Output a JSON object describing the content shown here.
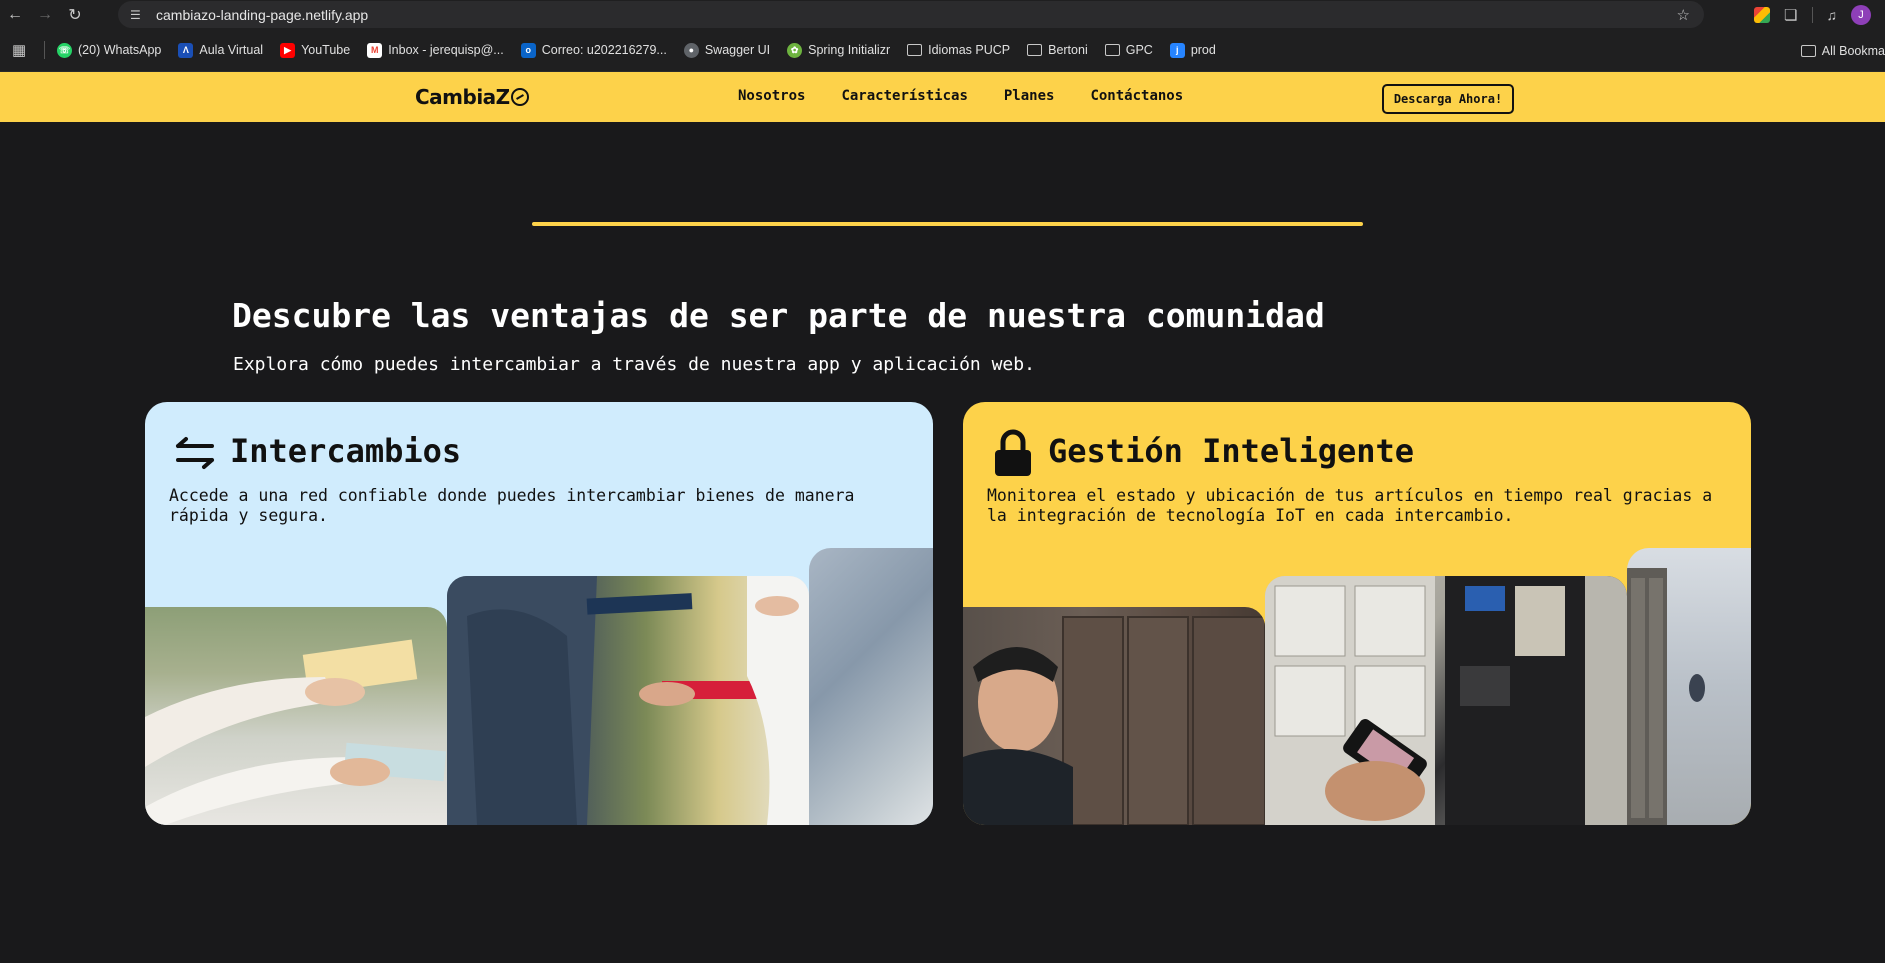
{
  "browser": {
    "url": "cambiazo-landing-page.netlify.app",
    "profile_initial": "J",
    "bookmarks": [
      {
        "label": "(20) WhatsApp",
        "icon": "whatsapp-icon",
        "color": "#25d366"
      },
      {
        "label": "Aula Virtual",
        "icon": "aula-virtual-icon",
        "color": "#1a4fb6"
      },
      {
        "label": "YouTube",
        "icon": "youtube-icon",
        "color": "#ff0000"
      },
      {
        "label": "Inbox - jerequisp@...",
        "icon": "gmail-icon",
        "color": "#ea4335"
      },
      {
        "label": "Correo: u202216279...",
        "icon": "outlook-icon",
        "color": "#0a64c8"
      },
      {
        "label": "Swagger UI",
        "icon": "globe-icon",
        "color": "#5f6368"
      },
      {
        "label": "Spring Initializr",
        "icon": "spring-icon",
        "color": "#6db33f"
      },
      {
        "label": "Idiomas PUCP",
        "icon": "folder-icon"
      },
      {
        "label": "Bertoni",
        "icon": "folder-icon"
      },
      {
        "label": "GPC",
        "icon": "folder-icon"
      },
      {
        "label": "prod",
        "icon": "jira-icon",
        "color": "#2684ff"
      }
    ],
    "all_bookmarks_label": "All Bookma"
  },
  "site": {
    "logo_text": "CambiaZ",
    "nav": [
      "Nosotros",
      "Características",
      "Planes",
      "Contáctanos"
    ],
    "cta_label": "Descarga Ahora!",
    "heading": "Descubre las ventajas de ser parte de nuestra comunidad",
    "subheading": "Explora cómo puedes intercambiar a través de nuestra app y aplicación web.",
    "cards": [
      {
        "title": "Intercambios",
        "icon": "exchange-arrows-icon",
        "description": "Accede a una red confiable donde puedes intercambiar bienes de manera rápida y segura.",
        "bg": "#d0ecfd"
      },
      {
        "title": "Gestión Inteligente",
        "icon": "lock-icon",
        "description": "Monitorea el estado y ubicación de tus artículos en tiempo real gracias a la integración de tecnología IoT en cada intercambio.",
        "bg": "#fdd24a"
      }
    ]
  },
  "colors": {
    "accent_yellow": "#fdd24a",
    "page_bg": "#19191b",
    "card_blue": "#d0ecfd"
  }
}
